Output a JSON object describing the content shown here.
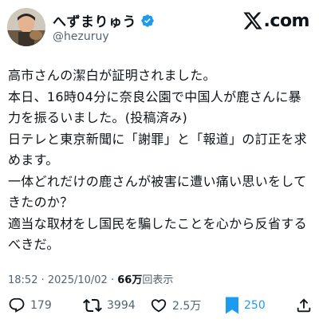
{
  "profile": {
    "display_name": "へずまりゅう",
    "handle": "@hezuruy"
  },
  "brand": {
    "text": "com",
    "separator": "."
  },
  "tweet": {
    "lines": [
      "高市さんの潔白が証明されました。",
      "本日、16時04分に奈良公園で中国人が鹿さんに暴",
      "力を振るいました。(投稿済み)",
      "日テレと東京新聞に「謝罪」と「報道」の訂正を求",
      "めます。",
      "一体どれだけの鹿さんが被害に遭い痛い思いをして",
      "きたのか？",
      "適当な取材をし国民を騙したことを心から反省する",
      "べきだ。"
    ]
  },
  "meta": {
    "time": "18:52",
    "separator": "·",
    "date": "2025/10/02",
    "views_count": "66万",
    "views_label": "回表示"
  },
  "actions": {
    "reply_count": "179",
    "retweet_count": "3994",
    "like_count": "2.5万",
    "bookmark_count": "250"
  },
  "colors": {
    "accent": "#1d9bf0",
    "muted": "#536471",
    "text": "#0f1419"
  }
}
